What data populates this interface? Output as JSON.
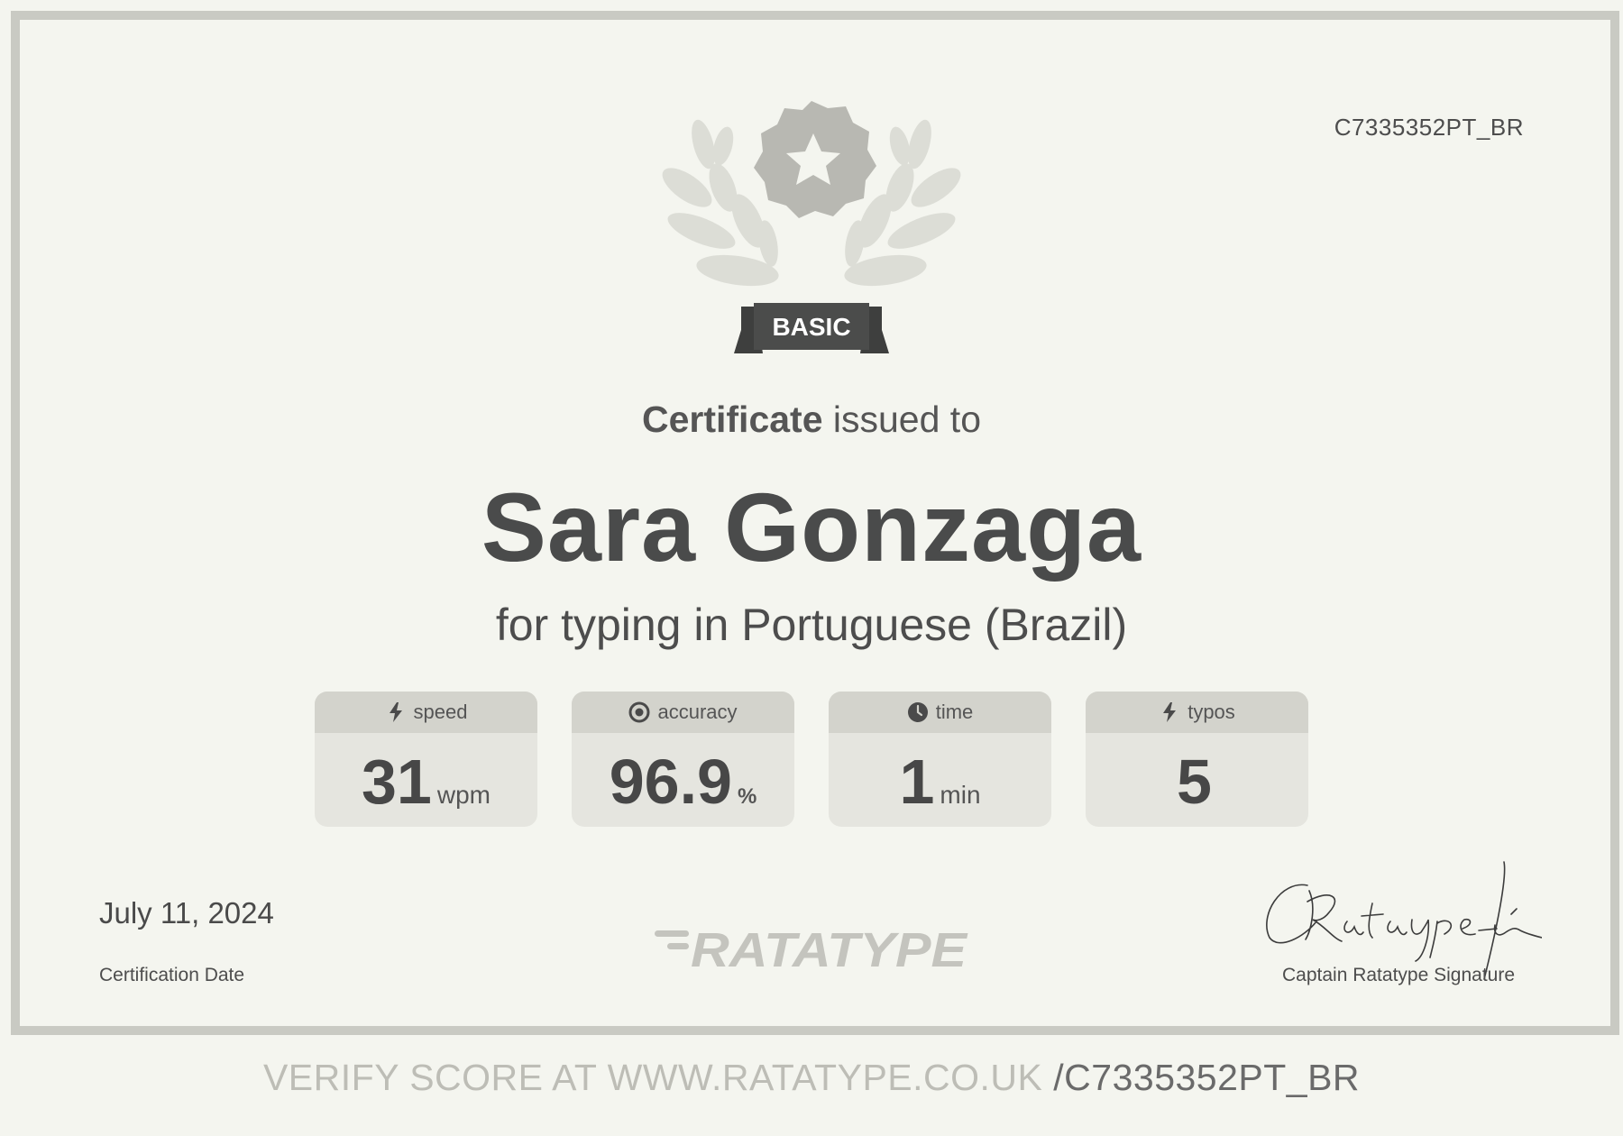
{
  "certificate": {
    "id": "C7335352PT_BR",
    "badge_label": "BASIC",
    "heading_strong": "Certificate",
    "heading_rest": " issued to",
    "recipient_name": "Sara Gonzaga",
    "course": "for typing in Portuguese (Brazil)"
  },
  "stats": [
    {
      "label": "speed",
      "icon": "lightning-icon",
      "value": "31",
      "unit": "wpm"
    },
    {
      "label": "accuracy",
      "icon": "target-icon",
      "value": "96.9",
      "unit": "%"
    },
    {
      "label": "time",
      "icon": "clock-icon",
      "value": "1",
      "unit": "min"
    },
    {
      "label": "typos",
      "icon": "lightning-icon",
      "value": "5",
      "unit": ""
    }
  ],
  "footer": {
    "date": "July 11, 2024",
    "date_label": "Certification Date",
    "logo_text": "RATATYPE",
    "signature_text": "CRatatype-fé",
    "signature_label": "Captain Ratatype Signature"
  },
  "verify": {
    "prefix": "VERIFY SCORE AT WWW.RATATYPE.CO.UK ",
    "id": "/C7335352PT_BR"
  },
  "colors": {
    "background": "#f4f5ef",
    "frame": "#c9cac3",
    "stat_card": "#e5e5df",
    "stat_header": "#d3d3cc",
    "text_dark": "#4a4a4a",
    "emblem_gray": "#b8b8b2",
    "laurel": "#dcddd6",
    "badge_dark": "#4b4c4b"
  }
}
